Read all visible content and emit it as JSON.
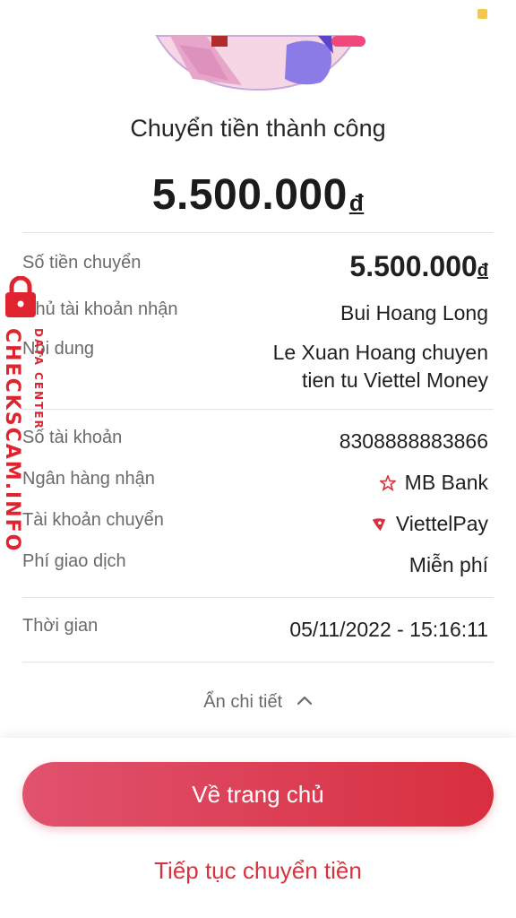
{
  "header": {
    "title": "Chuyển tiền thành công",
    "amount": "5.500.000",
    "currency": "đ"
  },
  "details": {
    "amount": {
      "label": "Số tiền chuyển",
      "value": "5.500.000",
      "currency": "đ"
    },
    "recipient_name": {
      "label": "Chủ tài khoản nhận",
      "value": "Bui Hoang Long"
    },
    "content": {
      "label": "Nội dung",
      "value_line1": "Le Xuan Hoang chuyen",
      "value_line2": "tien tu Viettel Money"
    },
    "account_number": {
      "label": "Số tài khoản",
      "value": "8308888883866"
    },
    "bank": {
      "label": "Ngân hàng nhận",
      "value": "MB Bank",
      "icon": "mb-bank-star-icon"
    },
    "source_account": {
      "label": "Tài khoản chuyển",
      "value": "ViettelPay",
      "icon": "viettelpay-icon"
    },
    "fee": {
      "label": "Phí giao dịch",
      "value": "Miễn phí"
    },
    "time": {
      "label": "Thời gian",
      "value": "05/11/2022 - 15:16:11"
    }
  },
  "toggle": {
    "label": "Ẩn chi tiết",
    "icon": "chevron-up-icon"
  },
  "actions": {
    "home_label": "Về trang chủ",
    "continue_label": "Tiếp tục chuyển tiền"
  },
  "watermark": {
    "brand": "CHECKSCAM.INFO",
    "sub": "DATA CENTER",
    "icon": "lock-icon"
  },
  "colors": {
    "accent": "#d8323f",
    "button_gradient_start": "#e0526e",
    "button_gradient_end": "#d82f3f",
    "label_gray": "#6a6a6a",
    "status_dot": "#f2c94c"
  }
}
